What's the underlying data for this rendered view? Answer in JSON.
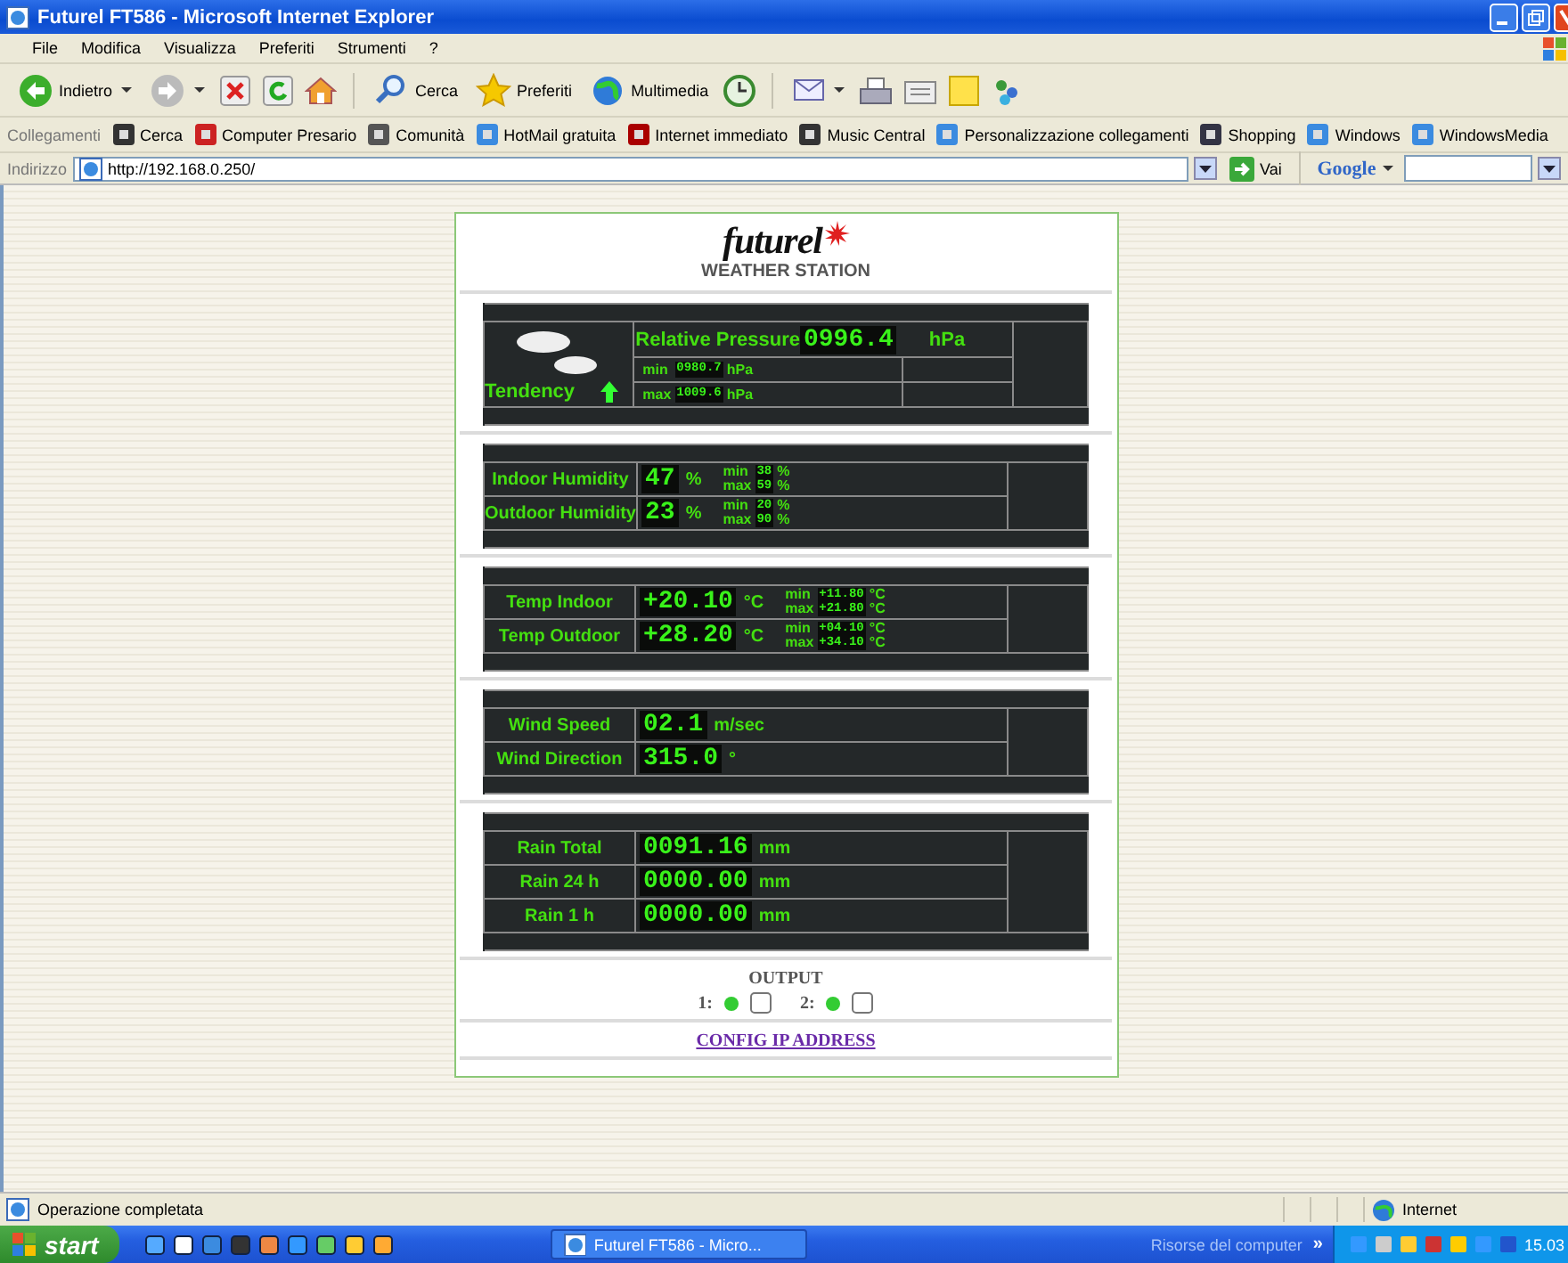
{
  "window": {
    "title": "Futurel FT586 - Microsoft Internet Explorer"
  },
  "menu": [
    "File",
    "Modifica",
    "Visualizza",
    "Preferiti",
    "Strumenti",
    "?"
  ],
  "toolbar": [
    "Indietro",
    "Cerca",
    "Preferiti",
    "Multimedia"
  ],
  "links": {
    "label": "Collegamenti",
    "items": [
      "Cerca",
      "Computer Presario",
      "Comunità",
      "HotMail gratuita",
      "Internet immediato",
      "Music Central",
      "Personalizzazione collegamenti",
      "Shopping",
      "Windows",
      "WindowsMedia"
    ]
  },
  "address": {
    "label": "Indirizzo",
    "value": "http://192.168.0.250/",
    "go": "Vai",
    "google": "Google"
  },
  "page": {
    "logo": "futurel",
    "subtitle": "WEATHER STATION",
    "sections": [
      {
        "kind": "pressure",
        "tendency": "Tendency",
        "title": "Relative Pressure",
        "value": "0996.4",
        "unit": "hPa",
        "min": {
          "label": "min",
          "value": "0980.7",
          "unit": "hPa"
        },
        "max": {
          "label": "max",
          "value": "1009.6",
          "unit": "hPa"
        }
      },
      {
        "kind": "readings",
        "rows": [
          {
            "label": "Indoor Humidity",
            "value": "47",
            "unit": "%",
            "min": {
              "label": "min",
              "value": "38",
              "unit": "%"
            },
            "max": {
              "label": "max",
              "value": "59",
              "unit": "%"
            }
          },
          {
            "label": "Outdoor Humidity",
            "value": "23",
            "unit": "%",
            "min": {
              "label": "min",
              "value": "20",
              "unit": "%"
            },
            "max": {
              "label": "max",
              "value": "90",
              "unit": "%"
            }
          }
        ]
      },
      {
        "kind": "readings",
        "rows": [
          {
            "label": "Temp Indoor",
            "value": "+20.10",
            "unit": "°C",
            "min": {
              "label": "min",
              "value": "+11.80",
              "unit": "°C"
            },
            "max": {
              "label": "max",
              "value": "+21.80",
              "unit": "°C"
            }
          },
          {
            "label": "Temp Outdoor",
            "value": "+28.20",
            "unit": "°C",
            "min": {
              "label": "min",
              "value": "+04.10",
              "unit": "°C"
            },
            "max": {
              "label": "max",
              "value": "+34.10",
              "unit": "°C"
            }
          }
        ]
      },
      {
        "kind": "readings",
        "rows": [
          {
            "label": "Wind Speed",
            "value": "02.1",
            "unit": "m/sec"
          },
          {
            "label": "Wind Direction",
            "value": "315.0",
            "unit": "°"
          }
        ]
      },
      {
        "kind": "readings",
        "rows": [
          {
            "label": "Rain Total",
            "value": "0091.16",
            "unit": "mm"
          },
          {
            "label": "Rain 24 h",
            "value": "0000.00",
            "unit": "mm"
          },
          {
            "label": "Rain 1 h",
            "value": "0000.00",
            "unit": "mm"
          }
        ]
      }
    ],
    "output": {
      "title": "OUTPUT",
      "items": [
        {
          "label": "1:",
          "on": true,
          "checked": false
        },
        {
          "label": "2:",
          "on": true,
          "checked": false
        }
      ]
    },
    "config_link": "CONFIG IP ADDRESS"
  },
  "status_bar": {
    "text": "Operazione completata",
    "zone": "Internet"
  },
  "taskbar": {
    "start": "start",
    "task": "Futurel FT586 - Micro...",
    "toolbar": "Risorse del computer",
    "more": "»",
    "clock": "15.03"
  }
}
